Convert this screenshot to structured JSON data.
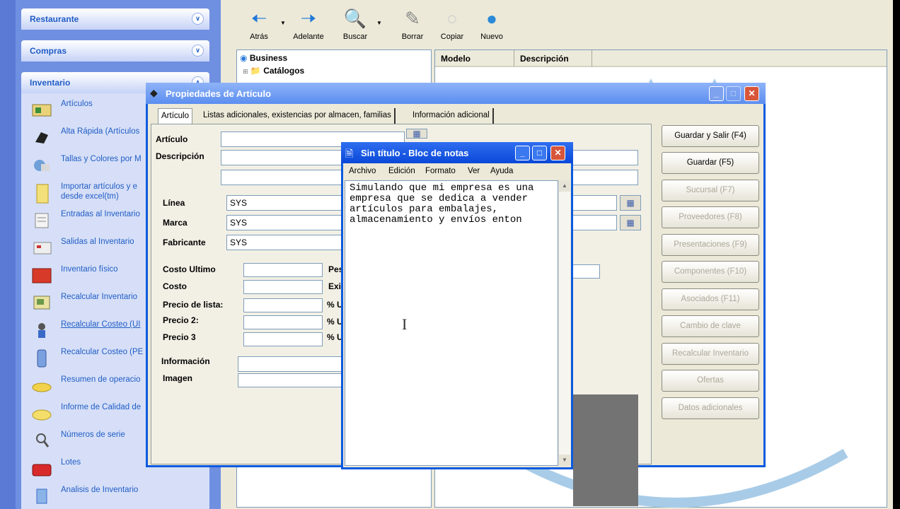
{
  "taskpane": {
    "groups": [
      {
        "label": "Restaurante"
      },
      {
        "label": "Compras"
      },
      {
        "label": "Inventario"
      }
    ],
    "inventario_items": [
      {
        "label": "Artículos",
        "icon": "articulos-icon"
      },
      {
        "label": "Alta Rápida (Artículos",
        "icon": "alta-rapida-icon"
      },
      {
        "label": "Tallas y Colores por M",
        "icon": "tallas-colores-icon"
      },
      {
        "label": "Importar artículos y e\ndesde excel(tm)",
        "icon": "importar-icon"
      },
      {
        "label": "Entradas al Inventario",
        "icon": "entradas-icon"
      },
      {
        "label": "Salidas al Inventario",
        "icon": "salidas-icon"
      },
      {
        "label": "Inventario físico",
        "icon": "inventario-fisico-icon"
      },
      {
        "label": "Recalcular Inventario",
        "icon": "recalcular-inventario-icon"
      },
      {
        "label": "Recalcular Costeo (UI",
        "icon": "recalcular-costeo-ui-icon"
      },
      {
        "label": "Recalcular Costeo (PE",
        "icon": "recalcular-costeo-pe-icon"
      },
      {
        "label": "Resumen de operacio",
        "icon": "resumen-icon"
      },
      {
        "label": "Informe de Calidad de",
        "icon": "informe-calidad-icon"
      },
      {
        "label": "Números de serie",
        "icon": "numeros-serie-icon"
      },
      {
        "label": "Lotes",
        "icon": "lotes-icon"
      },
      {
        "label": "Analisis de Inventario",
        "icon": "analisis-icon"
      }
    ]
  },
  "toolbar": {
    "atras": "Atrás",
    "adelante": "Adelante",
    "buscar": "Buscar",
    "borrar": "Borrar",
    "copiar": "Copiar",
    "nuevo": "Nuevo"
  },
  "tree": {
    "root": "Business",
    "child": "Catálogos"
  },
  "listview": {
    "col_modelo": "Modelo",
    "col_descripcion": "Descripción"
  },
  "dialog": {
    "title": "Propiedades de Artículo",
    "tabs": [
      "Artículo",
      "Listas adicionales, existencias por almacen, familias",
      "Información adicional"
    ],
    "labels": {
      "articulo": "Artículo",
      "descripcion": "Descripción",
      "linea": "Línea",
      "marca": "Marca",
      "fabricante": "Fabricante",
      "costo_ultimo": "Costo Ultimo",
      "costo": "Costo",
      "precio_lista": "Precio de lista:",
      "precio2": "Precio 2:",
      "precio3": "Precio 3",
      "informacion": "Información",
      "imagen": "Imagen",
      "pes": "Pes",
      "exi": "Exi",
      "u1": "% U",
      "u2": "% U",
      "u3": "% U"
    },
    "values": {
      "linea": "SYS",
      "marca": "SYS",
      "fabricante": "SYS"
    },
    "buttons": [
      {
        "label": "Guardar y Salir (F4)",
        "enabled": true
      },
      {
        "label": "Guardar (F5)",
        "enabled": true
      },
      {
        "label": "Sucursal (F7)",
        "enabled": false
      },
      {
        "label": "Proveedores (F8)",
        "enabled": false
      },
      {
        "label": "Presentaciones (F9)",
        "enabled": false
      },
      {
        "label": "Componentes (F10)",
        "enabled": false
      },
      {
        "label": "Asociados (F11)",
        "enabled": false
      },
      {
        "label": "Cambio de clave",
        "enabled": false
      },
      {
        "label": "Recalcular Inventario",
        "enabled": false
      },
      {
        "label": "Ofertas",
        "enabled": false
      },
      {
        "label": "Datos adicionales",
        "enabled": false
      }
    ]
  },
  "notepad": {
    "title": "Sin título - Bloc de notas",
    "menu": [
      "Archivo",
      "Edición",
      "Formato",
      "Ver",
      "Ayuda"
    ],
    "text": "Simulando que mi empresa es una empresa que se dedica a vender artículos para embalajes, almacenamiento y envíos enton"
  },
  "colors": {
    "xp_blue": "#0a5ae0",
    "taskpane_bg": "#6f8fe0",
    "link_blue": "#215dc6"
  }
}
